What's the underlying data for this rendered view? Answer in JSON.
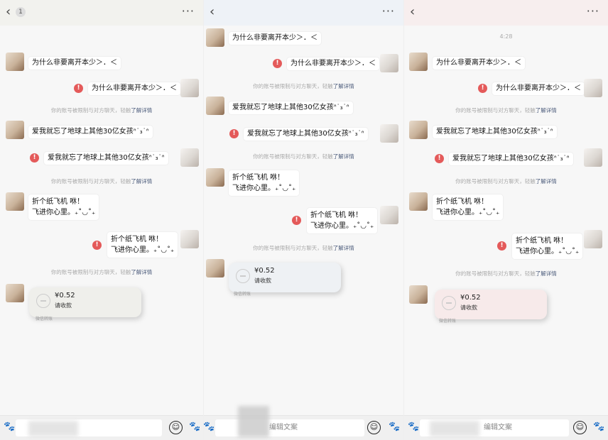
{
  "topbar": {
    "back_icon": "chevron-left-icon",
    "unread_count": "1",
    "more_label": "···"
  },
  "timestamp_partial": "4:28",
  "messages": {
    "q_leave": "为什么非要离开本少＞．＜",
    "q_forgot": "爱我就忘了地球上其他30亿女孩ᐢ˙₃˙ᐢ",
    "q_plane_1": "折个纸飞机   咻！",
    "q_plane_2": "飞进你心里。₊˚◡˚₊"
  },
  "notice": {
    "text": "你的账号被限制与对方聊天，轻触",
    "link": "了解详情"
  },
  "error_mark": "!",
  "red_packet": {
    "amount": "¥0.52",
    "desc": "请收款",
    "footer": "微信转账"
  },
  "bottom": {
    "placeholder": "编辑文案",
    "paw_icon": "🐾",
    "emoji_icon": "☺"
  }
}
